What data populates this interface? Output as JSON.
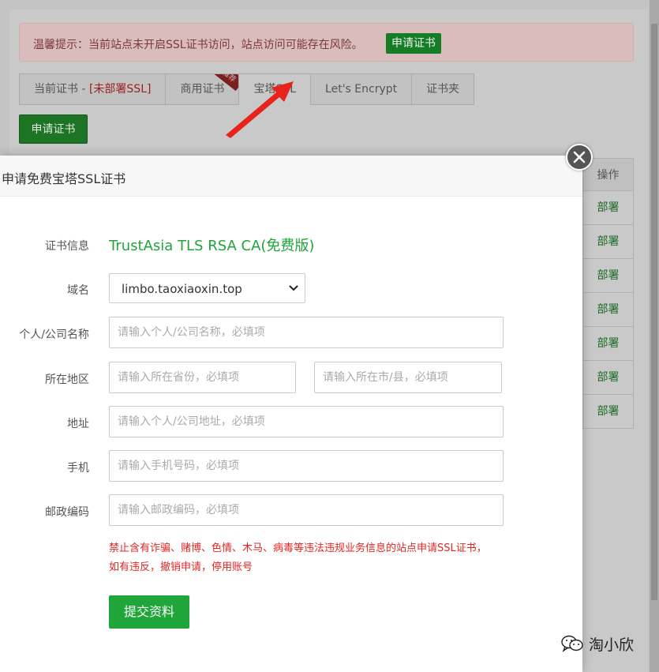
{
  "background": {
    "warning": {
      "text": "温馨提示：当前站点未开启SSL证书访问，站点访问可能存在风险。",
      "button": "申请证书"
    },
    "tabs": [
      {
        "label": "当前证书 - ",
        "extra": "[未部署SSL]"
      },
      {
        "label": "商用证书",
        "ribbon": "推荐"
      },
      {
        "label": "宝塔SSL"
      },
      {
        "label": "Let's Encrypt"
      },
      {
        "label": "证书夹"
      }
    ],
    "apply_button": "申请证书",
    "table": {
      "header": "操作",
      "rows": [
        "部署",
        "部署",
        "部署",
        "部署",
        "部署",
        "部署",
        "部署"
      ]
    }
  },
  "modal": {
    "title": "申请免费宝塔SSL证书",
    "fields": {
      "cert_info_label": "证书信息",
      "cert_info_value": "TrustAsia TLS RSA CA(免费版)",
      "domain_label": "域名",
      "domain_value": "limbo.taoxiaoxin.top",
      "company_label": "个人/公司名称",
      "company_placeholder": "请输入个人/公司名称，必填项",
      "region_label": "所在地区",
      "province_placeholder": "请输入所在省份，必填项",
      "city_placeholder": "请输入所在市/县，必填项",
      "address_label": "地址",
      "address_placeholder": "请输入个人/公司地址，必填项",
      "phone_label": "手机",
      "phone_placeholder": "请输入手机号码，必填项",
      "postcode_label": "邮政编码",
      "postcode_placeholder": "请输入邮政编码，必填项"
    },
    "notice_line1": "禁止含有诈骗、赌博、色情、木马、病毒等违法违规业务信息的站点申请SSL证书，",
    "notice_line2": "如有违反，撤销申请，停用账号",
    "submit": "提交资料"
  },
  "watermark": "淘小欣",
  "colors": {
    "accent_green": "#20a53a",
    "warning_red": "#e52525",
    "arrow_red": "#e8231c"
  }
}
